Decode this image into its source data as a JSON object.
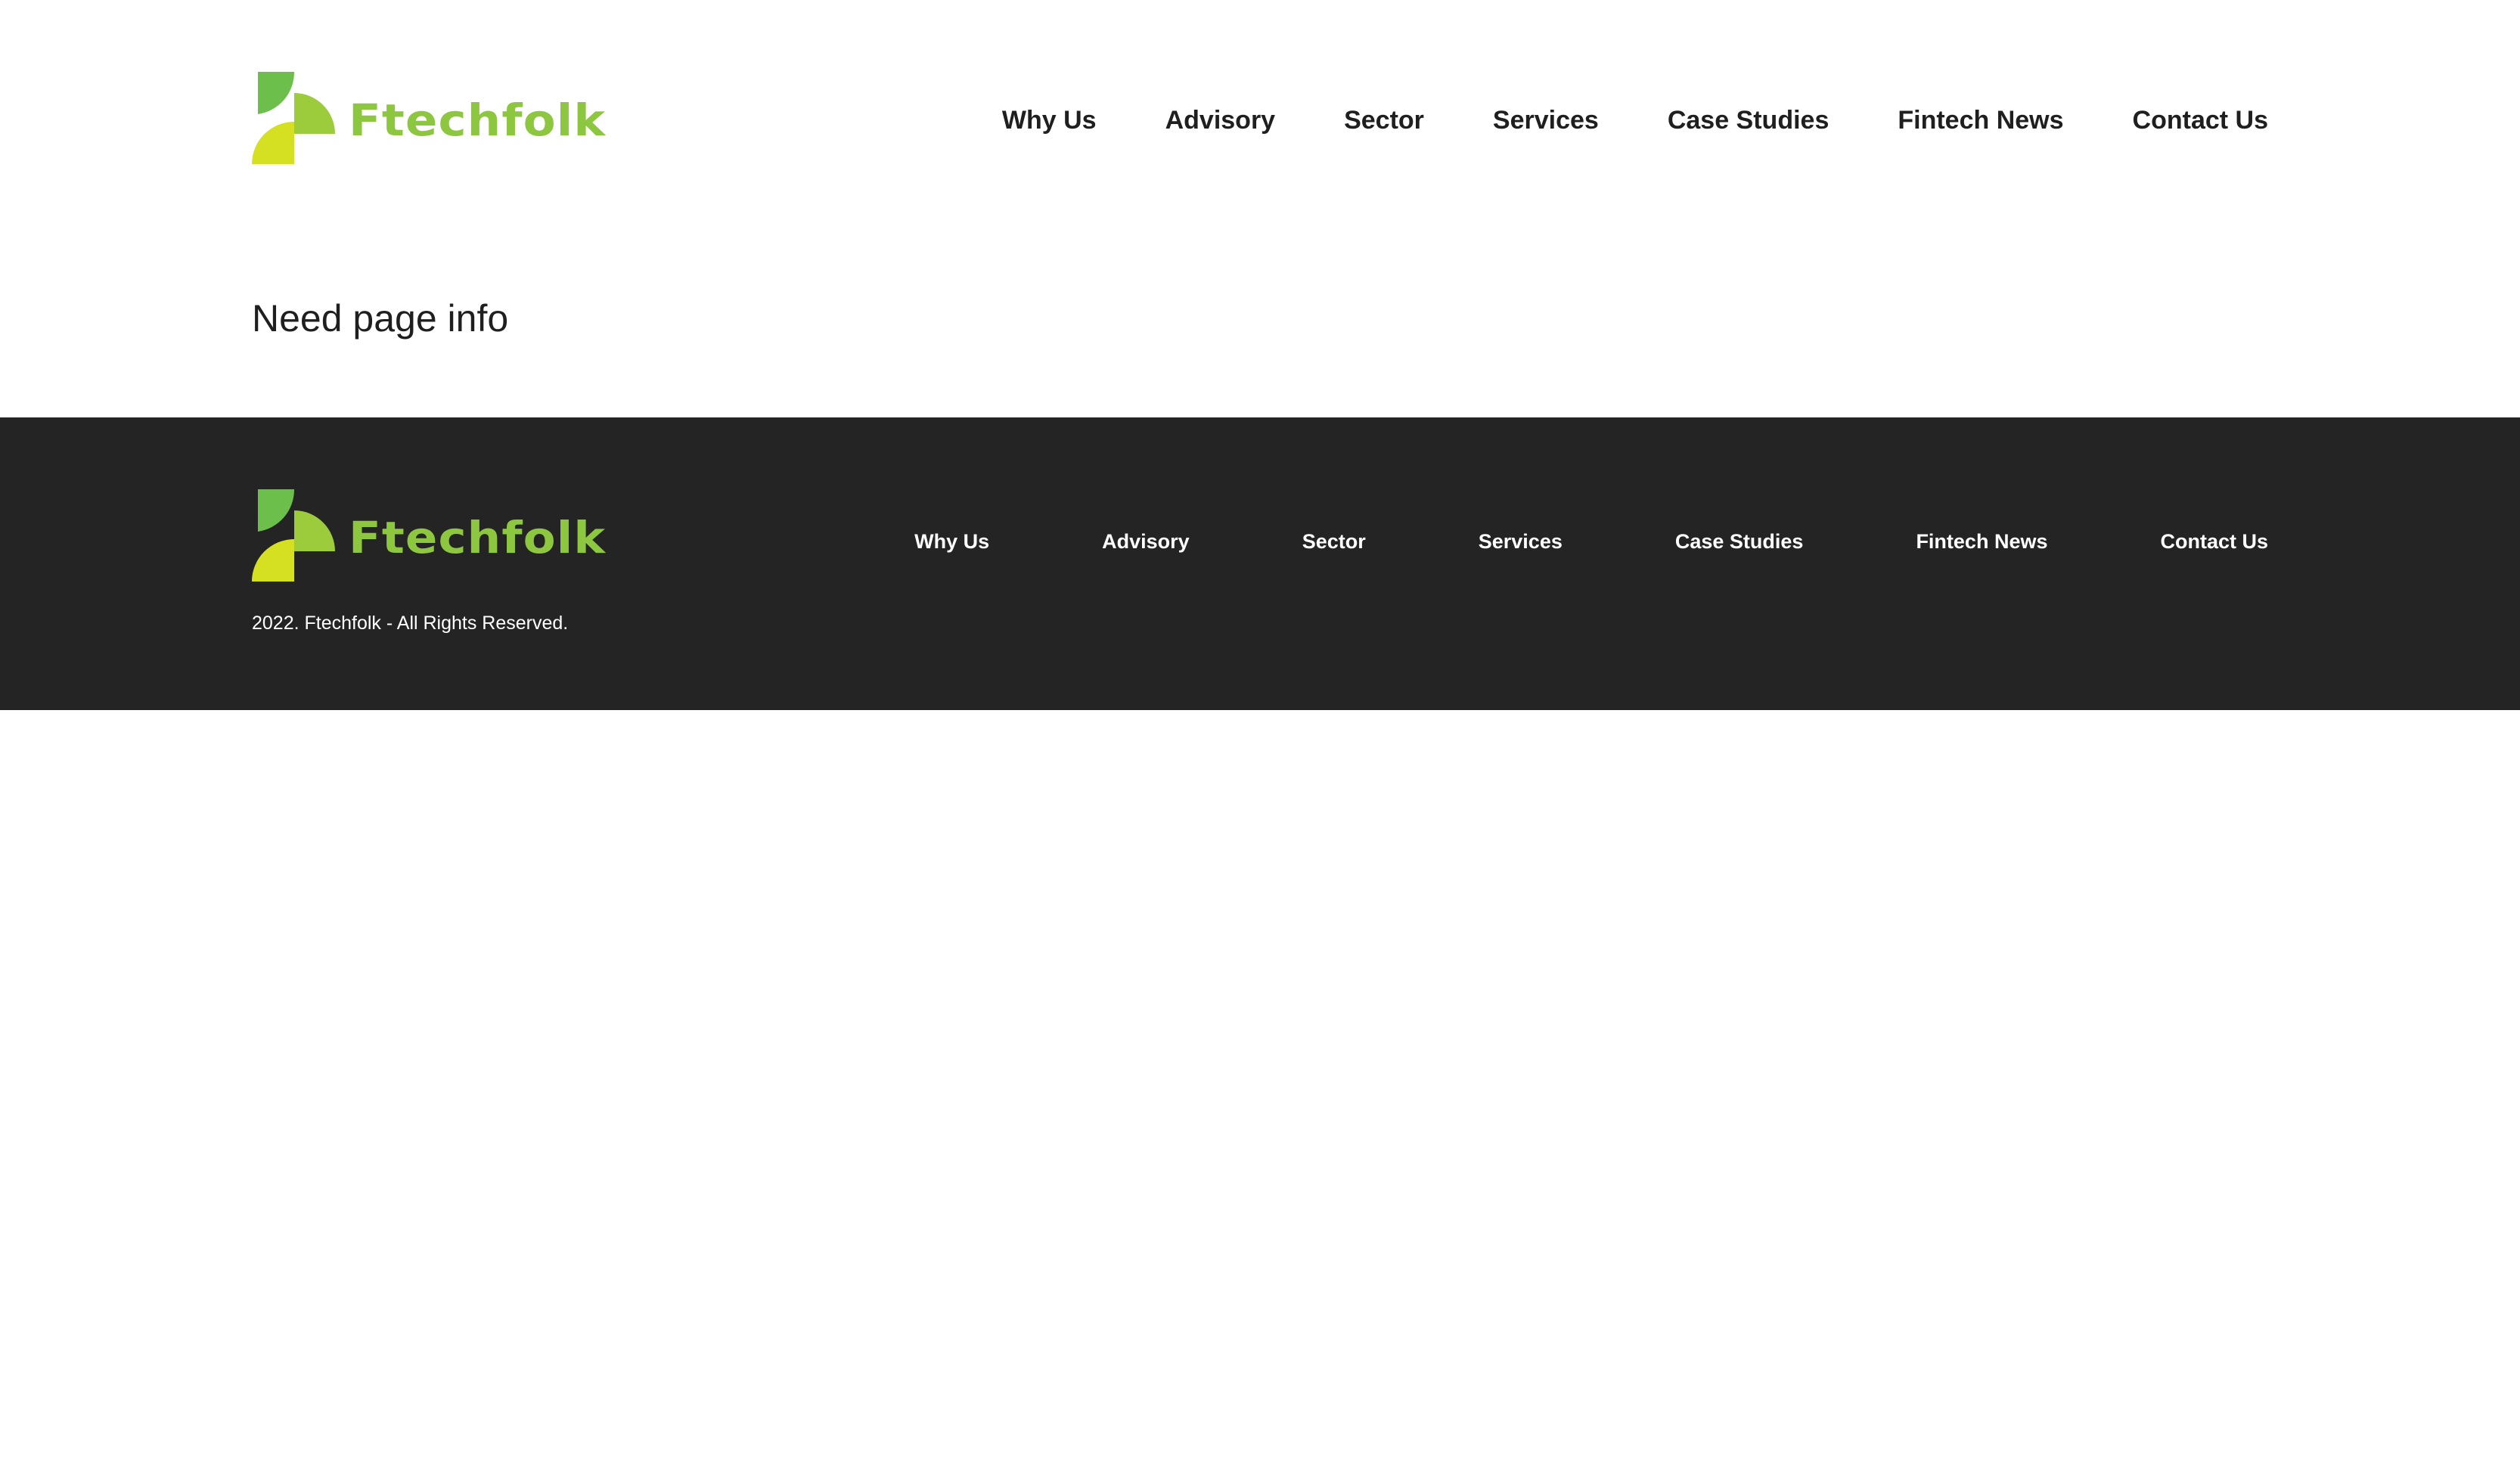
{
  "brand": {
    "name": "Ftechfolk",
    "colors": {
      "primary_green": "#8dc63f",
      "dark_green": "#6cbf4a",
      "lime": "#d4e021",
      "footer_bg": "#242424",
      "text_dark": "#1f1f1f"
    },
    "logo_icon": "ftechfolk-logo-mark"
  },
  "header": {
    "nav": [
      {
        "label": "Why Us"
      },
      {
        "label": "Advisory"
      },
      {
        "label": "Sector"
      },
      {
        "label": "Services"
      },
      {
        "label": "Case Studies"
      },
      {
        "label": "Fintech News"
      },
      {
        "label": "Contact Us"
      }
    ]
  },
  "main": {
    "heading": "Need page info"
  },
  "footer": {
    "nav": [
      {
        "label": "Why Us"
      },
      {
        "label": "Advisory"
      },
      {
        "label": "Sector"
      },
      {
        "label": "Services"
      },
      {
        "label": "Case Studies"
      },
      {
        "label": "Fintech News"
      },
      {
        "label": "Contact Us"
      }
    ],
    "copyright": "2022. Ftechfolk - All Rights Reserved."
  }
}
